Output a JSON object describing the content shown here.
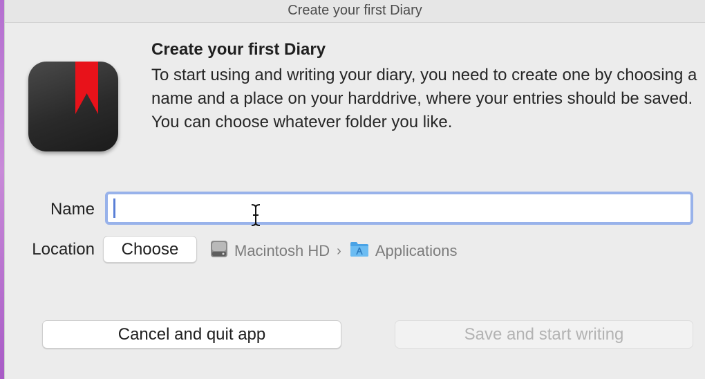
{
  "window": {
    "title": "Create your first Diary"
  },
  "intro": {
    "heading": "Create your first Diary",
    "description": "To start using and writing your diary, you need to create one by choosing a name and a place on your harddrive, where your entries should be saved. You can choose whatever folder you like.",
    "app_icon": "diary-bookmark-icon"
  },
  "form": {
    "name_label": "Name",
    "name_value": "",
    "name_placeholder": "",
    "location_label": "Location",
    "choose_label": "Choose",
    "path": [
      {
        "label": "Macintosh HD",
        "icon": "hard-drive-icon"
      },
      {
        "label": "Applications",
        "icon": "applications-folder-icon"
      }
    ],
    "path_separator": "›"
  },
  "actions": {
    "cancel_label": "Cancel and quit app",
    "save_label": "Save and start writing",
    "save_enabled": false
  },
  "colors": {
    "bookmark": "#e8121a",
    "focus_ring": "#98b2ea",
    "folder": "#5aa9e6"
  }
}
